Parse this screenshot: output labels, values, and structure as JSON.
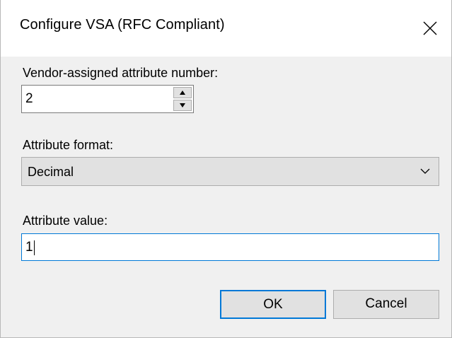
{
  "window": {
    "title": "Configure VSA (RFC Compliant)",
    "close_icon": "close-icon"
  },
  "attribute_number": {
    "label": "Vendor-assigned attribute number:",
    "value": "2"
  },
  "attribute_format": {
    "label": "Attribute format:",
    "selected": "Decimal"
  },
  "attribute_value": {
    "label": "Attribute value:",
    "value": "1"
  },
  "buttons": {
    "ok_label": "OK",
    "cancel_label": "Cancel"
  },
  "colors": {
    "focus_accent": "#0078d7",
    "dialog_background": "#f0f0f0",
    "titlebar_background": "#ffffff"
  }
}
